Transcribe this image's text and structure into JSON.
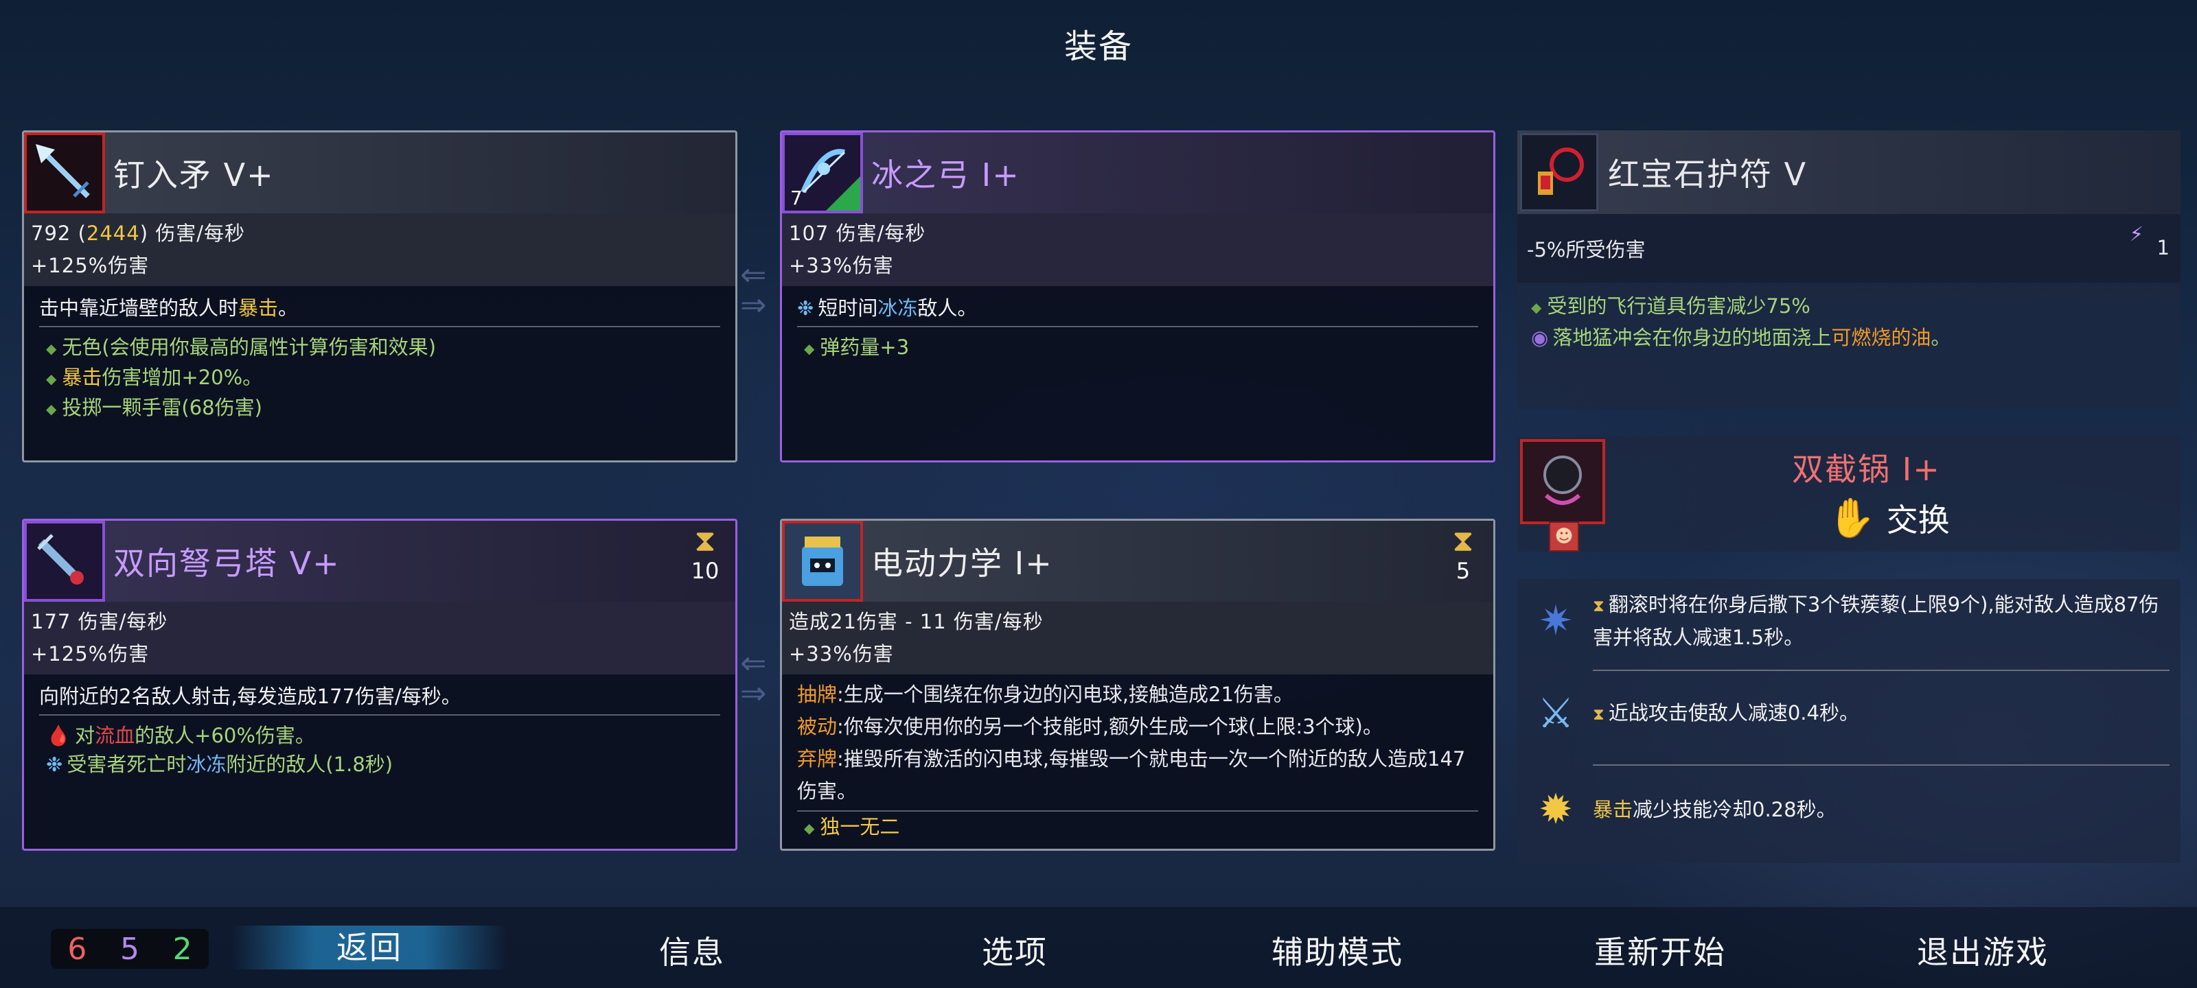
{
  "screen_title": "装备",
  "cards": [
    {
      "name": "钉入矛 V+",
      "icon": "spear-icon",
      "stat1_a": "792 (",
      "stat1_b": "2444",
      "stat1_c": ") 伤害/每秒",
      "stat2": "+125%伤害",
      "desc_a": "击中靠近墙壁的敌人时",
      "desc_b": "暴击",
      "desc_c": "。",
      "list1": "无色(会使用你最高的属性计算伤害和效果)",
      "list2_a": "暴击",
      "list2_b": "伤害增加+20%。",
      "list3": "投掷一颗手雷(68伤害)"
    },
    {
      "name": "冰之弓 I+",
      "icon": "ice-bow-icon",
      "icon_count": "7",
      "stat1": "107 伤害/每秒",
      "stat2": "+33%伤害",
      "desc_a": "短时间",
      "desc_b": "冰冻",
      "desc_c": "敌人。",
      "list1": "弹药量+3"
    },
    {
      "name": "双向弩弓塔 V+",
      "icon": "crossbow-turret-icon",
      "cooldown": "10",
      "stat1": "177 伤害/每秒",
      "stat2": "+125%伤害",
      "desc": "向附近的2名敌人射击,每发造成177伤害/每秒。",
      "list1_a": "对",
      "list1_b": "流血",
      "list1_c": "的敌人+60%伤害。",
      "list2_a": "受害者死亡时",
      "list2_b": "冰冻",
      "list2_c": "附近的敌人(1.8秒)"
    },
    {
      "name": "电动力学 I+",
      "icon": "electrodynamics-icon",
      "cooldown": "5",
      "stat1": "造成21伤害 - 11 伤害/每秒",
      "stat2": "+33%伤害",
      "l1_key": "抽牌",
      "l1_val": ":生成一个围绕在你身边的闪电球,接触造成21伤害。",
      "l2_key": "被动",
      "l2_val": ":你每次使用你的另一个技能时,额外生成一个球(上限:3个球)。",
      "l3_key": "弃牌",
      "l3_val": ":摧毁所有激活的闪电球,每摧毁一个就电击一次一个附近的敌人造成147伤害。",
      "unique": "独一无二"
    }
  ],
  "amulet": {
    "name": "红宝石护符 V",
    "stat": "-5%所受伤害",
    "scroll_count": "1",
    "line1": "受到的飞行道具伤害减少75%",
    "line2_a": "落地猛冲会在你身边的地面浇上",
    "line2_b": "可燃烧的油",
    "line2_c": "。"
  },
  "mutation": {
    "name": "双截锅 I+",
    "swap_label": "交换"
  },
  "perks": [
    {
      "text": "翻滚时将在你身后撒下3个铁蒺藜(上限9个),能对敌人造成87伤害并将敌人减速1.5秒。"
    },
    {
      "text": "近战攻击使敌人减速0.4秒。"
    },
    {
      "text_a": "暴击",
      "text_b": "减少技能冷却0.28秒。"
    }
  ],
  "scroll_stats": {
    "brutality": "6",
    "tactics": "5",
    "survival": "2"
  },
  "menu": {
    "back": "返回",
    "info": "信息",
    "options": "选项",
    "assist": "辅助模式",
    "restart": "重新开始",
    "quit": "退出游戏"
  },
  "colors": {
    "gray_border": "#8f96a3",
    "purple_border": "#9a5fe0",
    "red_frame": "#c02525",
    "highlight_gold": "#f2c744",
    "ice_blue": "#6fb9f2",
    "effect_green": "#a6d47a"
  }
}
